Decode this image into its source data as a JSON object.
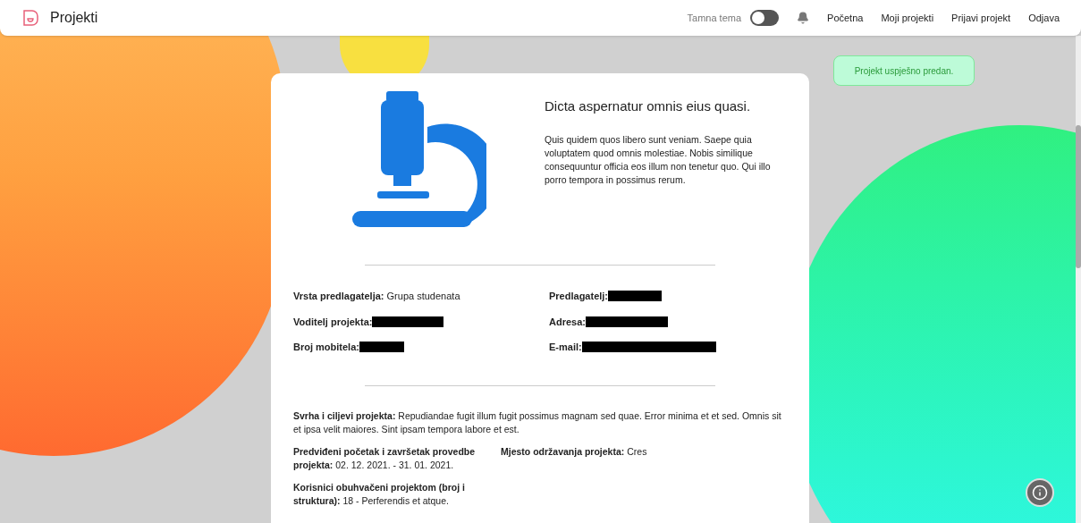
{
  "navbar": {
    "brand": "Projekti",
    "theme_toggle": {
      "label": "Tamna tema",
      "on": false
    },
    "links": [
      "Početna",
      "Moji projekti",
      "Prijavi projekt",
      "Odjava"
    ]
  },
  "toast": {
    "message": "Projekt uspješno predan."
  },
  "project": {
    "title": "Dicta aspernatur omnis eius quasi.",
    "description": "Quis quidem quos libero sunt veniam. Saepe quia voluptatem quod omnis molestiae. Nobis similique consequuntur officia eos illum non tenetur quo. Qui illo porro tempora in possimus rerum.",
    "contacts": [
      {
        "label": "Vrsta predlagatelja:",
        "value": "Grupa studenata",
        "redacted": false
      },
      {
        "label": "Predlagatelj:",
        "redacted": true
      },
      {
        "label": "Voditelj projekta:",
        "redacted": true
      },
      {
        "label": "Adresa:",
        "redacted": true
      },
      {
        "label": "Broj mobitela:",
        "redacted": true
      },
      {
        "label": "E-mail:",
        "redacted": true
      }
    ],
    "purpose": {
      "label": "Svrha i ciljevi projekta:",
      "value": "Repudiandae fugit illum fugit possimus magnam sed quae. Error minima et et sed. Omnis sit et ipsa velit maiores. Sint ipsam tempora labore et est."
    },
    "details": [
      {
        "label": "Predviđeni početak i završetak provedbe projekta:",
        "value": "02. 12. 2021. - 31. 01. 2021."
      },
      {
        "label": "Mjesto održavanja projekta:",
        "value": "Cres"
      },
      {
        "label": "Korisnici obuhvačeni projektom (broj i struktura):",
        "value": "18 - Perferendis et atque."
      }
    ]
  }
}
